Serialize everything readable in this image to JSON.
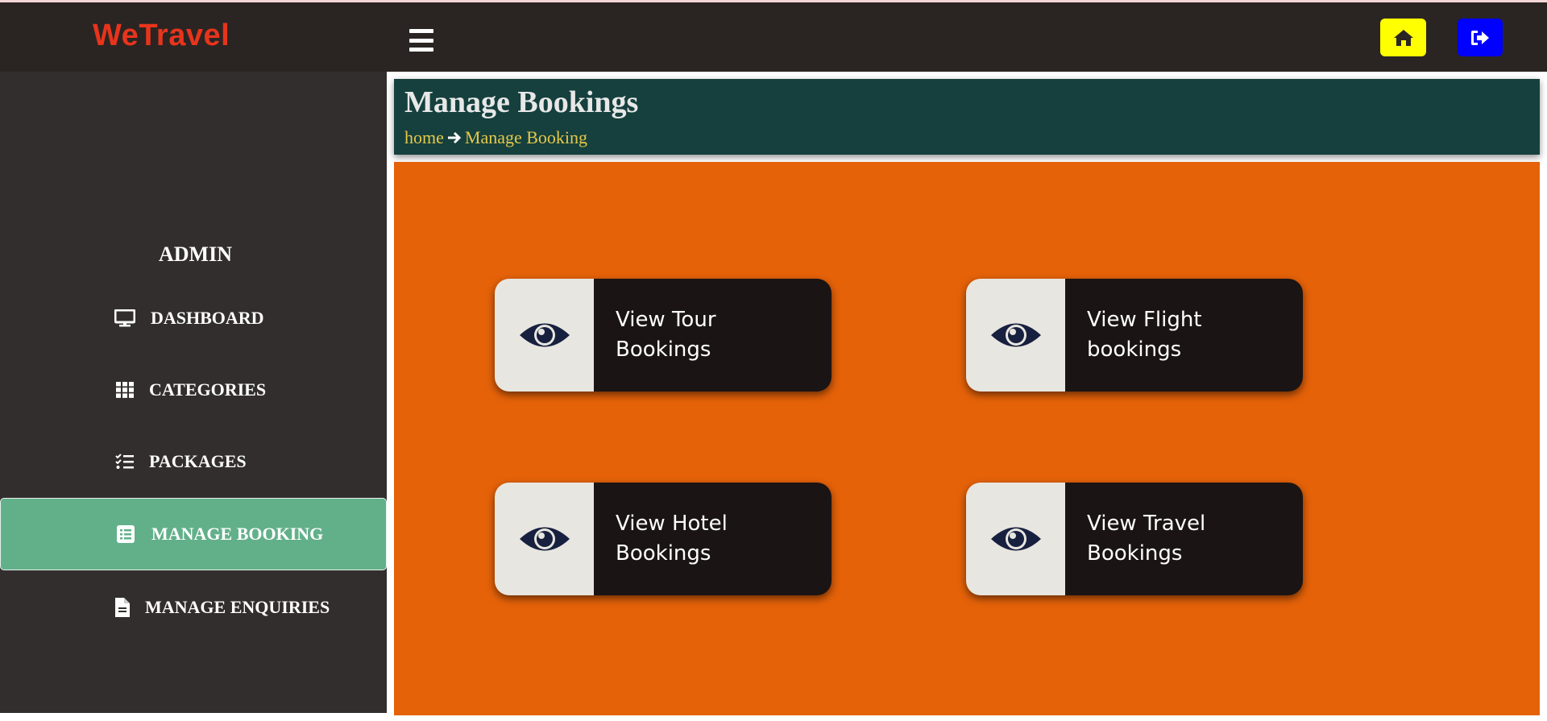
{
  "app": {
    "brand": "WeTravel"
  },
  "topbar": {
    "menu_icon": "hamburger-icon",
    "home_icon": "home-icon",
    "logout_icon": "sign-out-icon",
    "home_color": "#ffff00",
    "logout_color": "#0000ff"
  },
  "sidebar": {
    "title": "ADMIN",
    "items": [
      {
        "label": "DASHBOARD",
        "icon": "desktop-icon"
      },
      {
        "label": "CATEGORIES",
        "icon": "grid-icon"
      },
      {
        "label": "PACKAGES",
        "icon": "checklist-icon"
      },
      {
        "label": "MANAGE BOOKING",
        "icon": "list-alt-icon",
        "active": true
      },
      {
        "label": "MANAGE ENQUIRIES",
        "icon": "file-icon"
      }
    ],
    "active_color": "#62b08a"
  },
  "header": {
    "title": "Manage Bookings",
    "breadcrumb": {
      "home": "home",
      "current": "Manage Booking"
    }
  },
  "cards": [
    {
      "label": "View Tour Bookings",
      "icon": "eye-icon"
    },
    {
      "label": "View Flight bookings",
      "icon": "eye-icon"
    },
    {
      "label": "View Hotel Bookings",
      "icon": "eye-icon"
    },
    {
      "label": "View Travel Bookings",
      "icon": "eye-icon"
    }
  ],
  "colors": {
    "topbar": "#2a2523",
    "sidebar": "#332e2e",
    "header": "#15403d",
    "content": "#e56209",
    "brand": "#e8341c"
  }
}
